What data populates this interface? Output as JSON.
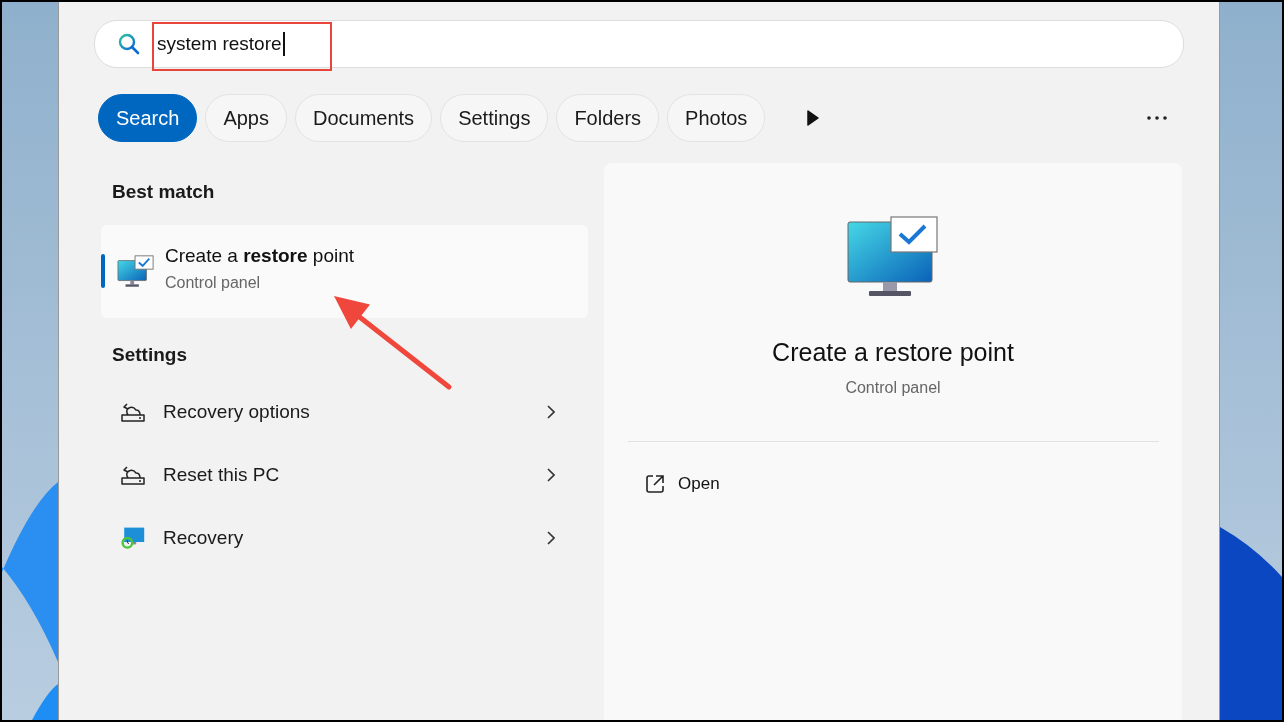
{
  "search": {
    "value": "system restore"
  },
  "filters": [
    {
      "label": "Search",
      "selected": true
    },
    {
      "label": "Apps",
      "selected": false
    },
    {
      "label": "Documents",
      "selected": false
    },
    {
      "label": "Settings",
      "selected": false
    },
    {
      "label": "Folders",
      "selected": false
    },
    {
      "label": "Photos",
      "selected": false
    }
  ],
  "best_match": {
    "heading": "Best match",
    "items": [
      {
        "title": "Create a **restore** point",
        "subtitle": "Control panel",
        "selected": true
      }
    ]
  },
  "settings": {
    "heading": "Settings",
    "items": [
      {
        "label": "Recovery options",
        "kind": "setting"
      },
      {
        "label": "Reset this PC",
        "kind": "setting"
      },
      {
        "label": "Recovery",
        "kind": "app"
      }
    ]
  },
  "preview": {
    "title": "Create a restore point",
    "subtitle": "Control panel",
    "actions": [
      {
        "label": "Open"
      }
    ]
  }
}
